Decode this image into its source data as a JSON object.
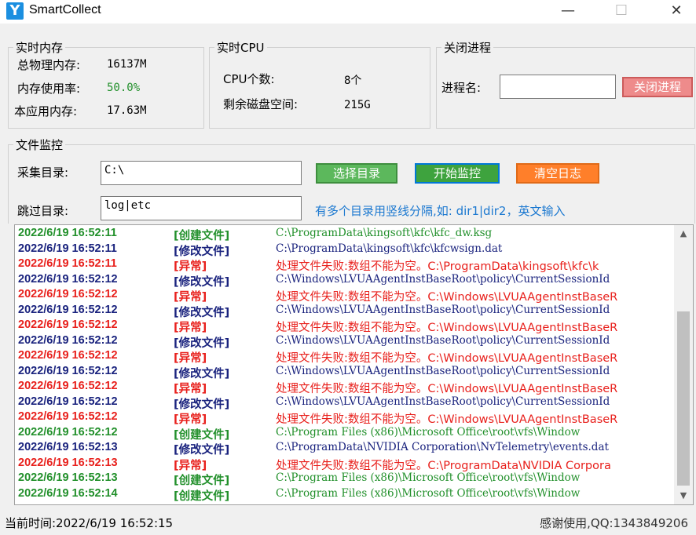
{
  "window": {
    "title": "SmartCollect",
    "icon_letter": "Y",
    "minimize": "—",
    "maximize": "☐",
    "close": "✕"
  },
  "memory": {
    "title": "实时内存",
    "total_label": "总物理内存:",
    "total_value": "16137M",
    "usage_label": "内存使用率:",
    "usage_value": "50.0%",
    "app_label": "本应用内存:",
    "app_value": "17.63M"
  },
  "cpu": {
    "title": "实时CPU",
    "count_label": "CPU个数:",
    "count_value": "8个",
    "disk_label": "剩余磁盘空间:",
    "disk_value": "215G"
  },
  "kill": {
    "title": "关闭进程",
    "name_label": "进程名:",
    "name_value": "",
    "button": "关闭进程"
  },
  "monitor": {
    "title": "文件监控",
    "collect_label": "采集目录:",
    "collect_value": "C:\\",
    "select_button": "选择目录",
    "start_button": "开始监控",
    "clear_button": "清空日志",
    "skip_label": "跳过目录:",
    "skip_value": "log|etc",
    "hint": "有多个目录用竖线分隔,如: dir1|dir2，英文输入"
  },
  "colors": {
    "create": "#22902b",
    "modify": "#1a237e",
    "error": "#e8201c",
    "create_msg": "#22902b",
    "modify_msg": "#1a237e"
  },
  "log": [
    {
      "time": "2022/6/19 16:52:11",
      "kind": "[创建文件]",
      "type": "create",
      "msg": "C:\\ProgramData\\kingsoft\\kfc\\kfc_dw.ksg"
    },
    {
      "time": "2022/6/19 16:52:11",
      "kind": "[修改文件]",
      "type": "modify",
      "msg": "C:\\ProgramData\\kingsoft\\kfc\\kfcwsign.dat"
    },
    {
      "time": "2022/6/19 16:52:11",
      "kind": "[异常]",
      "type": "error",
      "msg": "处理文件失败:数组不能为空。C:\\ProgramData\\kingsoft\\kfc\\k"
    },
    {
      "time": "2022/6/19 16:52:12",
      "kind": "[修改文件]",
      "type": "modify",
      "msg": "C:\\Windows\\LVUAAgentInstBaseRoot\\policy\\CurrentSessionId"
    },
    {
      "time": "2022/6/19 16:52:12",
      "kind": "[异常]",
      "type": "error",
      "msg": "处理文件失败:数组不能为空。C:\\Windows\\LVUAAgentInstBaseR"
    },
    {
      "time": "2022/6/19 16:52:12",
      "kind": "[修改文件]",
      "type": "modify",
      "msg": "C:\\Windows\\LVUAAgentInstBaseRoot\\policy\\CurrentSessionId"
    },
    {
      "time": "2022/6/19 16:52:12",
      "kind": "[异常]",
      "type": "error",
      "msg": "处理文件失败:数组不能为空。C:\\Windows\\LVUAAgentInstBaseR"
    },
    {
      "time": "2022/6/19 16:52:12",
      "kind": "[修改文件]",
      "type": "modify",
      "msg": "C:\\Windows\\LVUAAgentInstBaseRoot\\policy\\CurrentSessionId"
    },
    {
      "time": "2022/6/19 16:52:12",
      "kind": "[异常]",
      "type": "error",
      "msg": "处理文件失败:数组不能为空。C:\\Windows\\LVUAAgentInstBaseR"
    },
    {
      "time": "2022/6/19 16:52:12",
      "kind": "[修改文件]",
      "type": "modify",
      "msg": "C:\\Windows\\LVUAAgentInstBaseRoot\\policy\\CurrentSessionId"
    },
    {
      "time": "2022/6/19 16:52:12",
      "kind": "[异常]",
      "type": "error",
      "msg": "处理文件失败:数组不能为空。C:\\Windows\\LVUAAgentInstBaseR"
    },
    {
      "time": "2022/6/19 16:52:12",
      "kind": "[修改文件]",
      "type": "modify",
      "msg": "C:\\Windows\\LVUAAgentInstBaseRoot\\policy\\CurrentSessionId"
    },
    {
      "time": "2022/6/19 16:52:12",
      "kind": "[异常]",
      "type": "error",
      "msg": "处理文件失败:数组不能为空。C:\\Windows\\LVUAAgentInstBaseR"
    },
    {
      "time": "2022/6/19 16:52:12",
      "kind": "[创建文件]",
      "type": "create",
      "msg": "C:\\Program Files (x86)\\Microsoft Office\\root\\vfs\\Window"
    },
    {
      "time": "2022/6/19 16:52:13",
      "kind": "[修改文件]",
      "type": "modify",
      "msg": "C:\\ProgramData\\NVIDIA Corporation\\NvTelemetry\\events.dat"
    },
    {
      "time": "2022/6/19 16:52:13",
      "kind": "[异常]",
      "type": "error",
      "msg": "处理文件失败:数组不能为空。C:\\ProgramData\\NVIDIA Corpora"
    },
    {
      "time": "2022/6/19 16:52:13",
      "kind": "[创建文件]",
      "type": "create",
      "msg": "C:\\Program Files (x86)\\Microsoft Office\\root\\vfs\\Window"
    },
    {
      "time": "2022/6/19 16:52:14",
      "kind": "[创建文件]",
      "type": "create",
      "msg": "C:\\Program Files (x86)\\Microsoft Office\\root\\vfs\\Window"
    }
  ],
  "status": {
    "time_label": "当前时间:2022/6/19 16:52:15",
    "contact": "感谢使用,QQ:1343849206"
  }
}
